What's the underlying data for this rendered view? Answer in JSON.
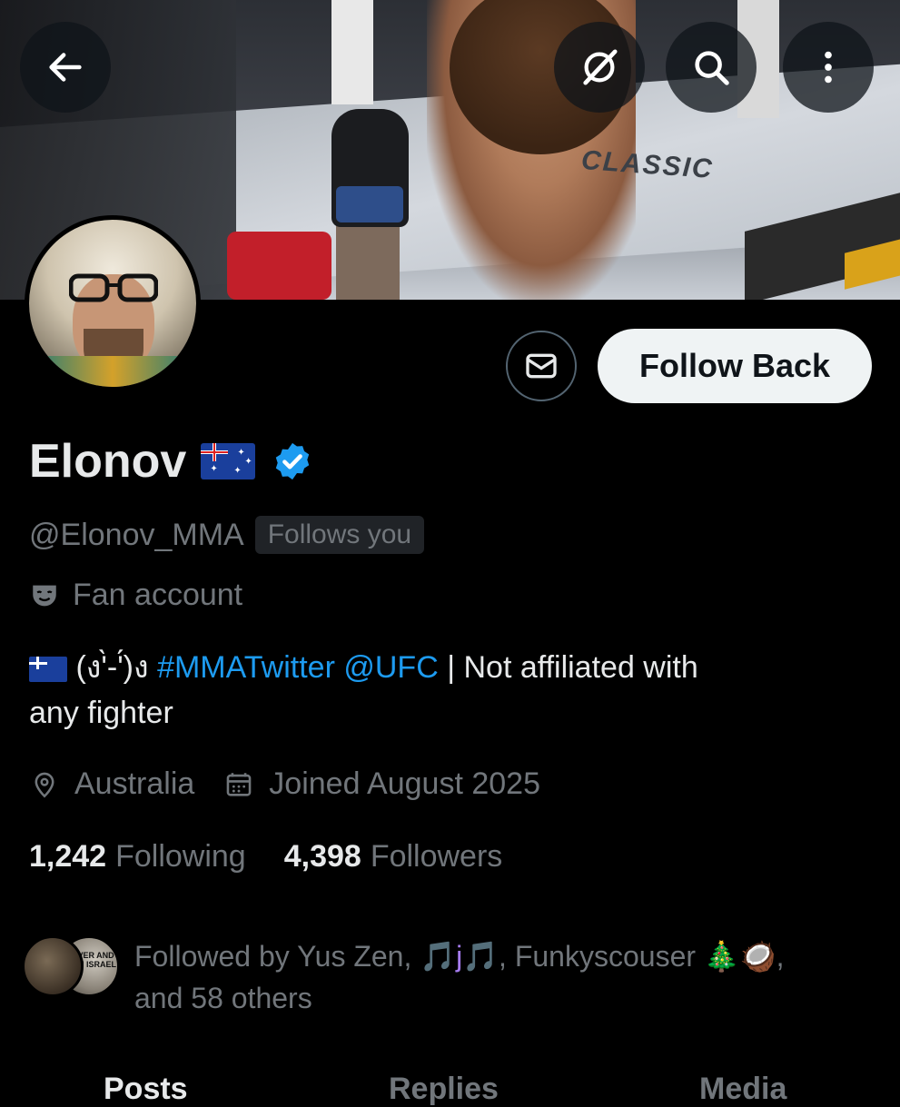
{
  "header": {
    "back_icon": "arrow-left-icon",
    "grok_icon": "grok-icon",
    "search_icon": "search-icon",
    "more_icon": "more-vertical-icon"
  },
  "banner": {
    "mat_text": "CLASSIC"
  },
  "profile": {
    "name": "Elonov",
    "flag_emoji": "🇦🇺",
    "verified": true,
    "handle": "@Elonov_MMA",
    "follows_you_badge": "Follows you",
    "category": "Fan account",
    "bio": {
      "flag": "🇦🇺",
      "kaomoji": "(ง'̀-'́)ง",
      "hashtag": "#MMATwitter",
      "mention": "@UFC",
      "rest_line1": " | Not affiliated with",
      "rest_line2": "any fighter"
    },
    "location": "Australia",
    "joined": "Joined August 2025",
    "following_count": "1,242",
    "following_label": "Following",
    "followers_count": "4,398",
    "followers_label": "Followers"
  },
  "actions": {
    "message_icon": "mail-icon",
    "follow_back_label": "Follow Back"
  },
  "followed_by": {
    "prefix": "Followed by Yus Zen, ",
    "name2_note": "🎵j🎵",
    "name3": ", Funkyscouser 🎄🥥,",
    "suffix": "and 58 others",
    "avatar1_text": "NEVER AND YOU ISRAEL"
  },
  "tabs": [
    {
      "label": "Posts",
      "active": true
    },
    {
      "label": "Replies",
      "active": false
    },
    {
      "label": "Media",
      "active": false
    }
  ],
  "colors": {
    "background": "#000000",
    "primary_text": "#e7e9ea",
    "secondary_text": "#71767b",
    "link": "#1d9bf0",
    "verified": "#1d9bf0"
  }
}
